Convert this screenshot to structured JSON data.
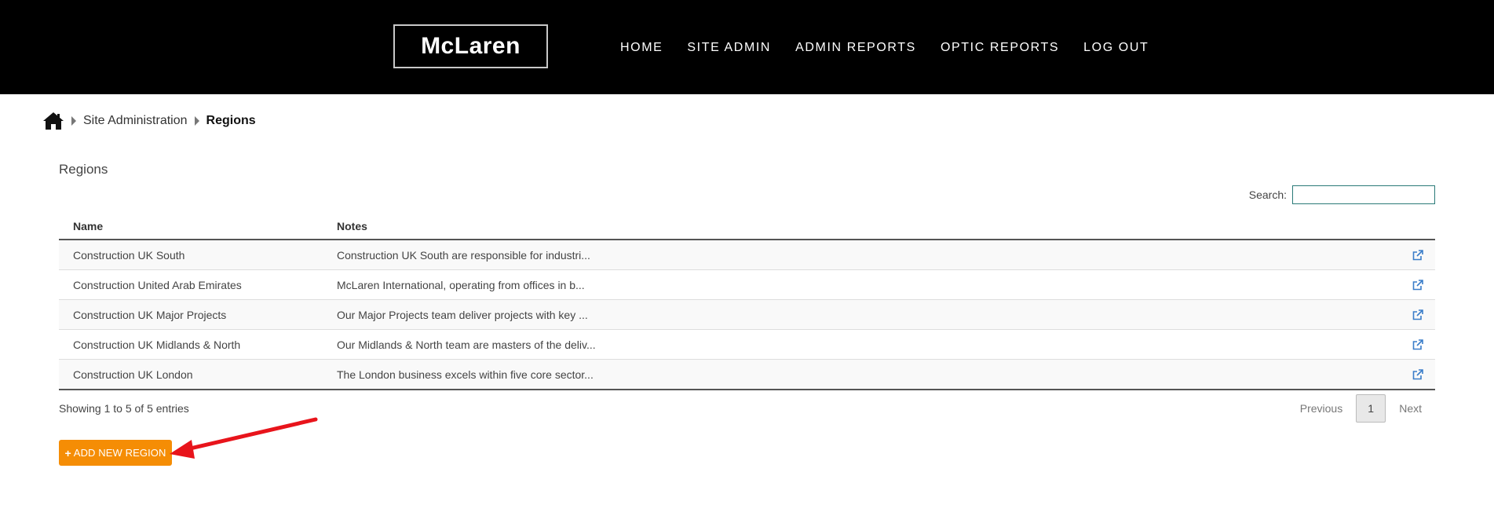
{
  "header": {
    "logo_text": "McLaren",
    "nav": [
      "HOME",
      "SITE ADMIN",
      "ADMIN REPORTS",
      "OPTIC REPORTS",
      "LOG OUT"
    ]
  },
  "breadcrumb": {
    "items": [
      "Site Administration",
      "Regions"
    ]
  },
  "page": {
    "title": "Regions",
    "search_label": "Search:",
    "search_value": ""
  },
  "table": {
    "headers": [
      "Name",
      "Notes"
    ],
    "rows": [
      {
        "name": "Construction UK South",
        "notes": "Construction UK South are responsible for industri..."
      },
      {
        "name": "Construction United Arab Emirates",
        "notes": "McLaren International, operating from offices in b..."
      },
      {
        "name": "Construction UK Major Projects",
        "notes": "Our Major Projects team deliver projects with key ..."
      },
      {
        "name": "Construction UK Midlands & North",
        "notes": "Our Midlands & North team are masters of the deliv..."
      },
      {
        "name": "Construction UK London",
        "notes": "The London business excels within five core sector..."
      }
    ]
  },
  "footer": {
    "info": "Showing 1 to 5 of 5 entries",
    "previous": "Previous",
    "page": "1",
    "next": "Next"
  },
  "actions": {
    "add_label": "ADD NEW REGION"
  },
  "colors": {
    "header_bg": "#000000",
    "accent": "#f58d05",
    "link_icon": "#3a7dc9",
    "arrow": "#e8141b"
  },
  "icons": [
    "home-icon",
    "external-link-icon",
    "plus-icon",
    "arrow-annotation"
  ]
}
